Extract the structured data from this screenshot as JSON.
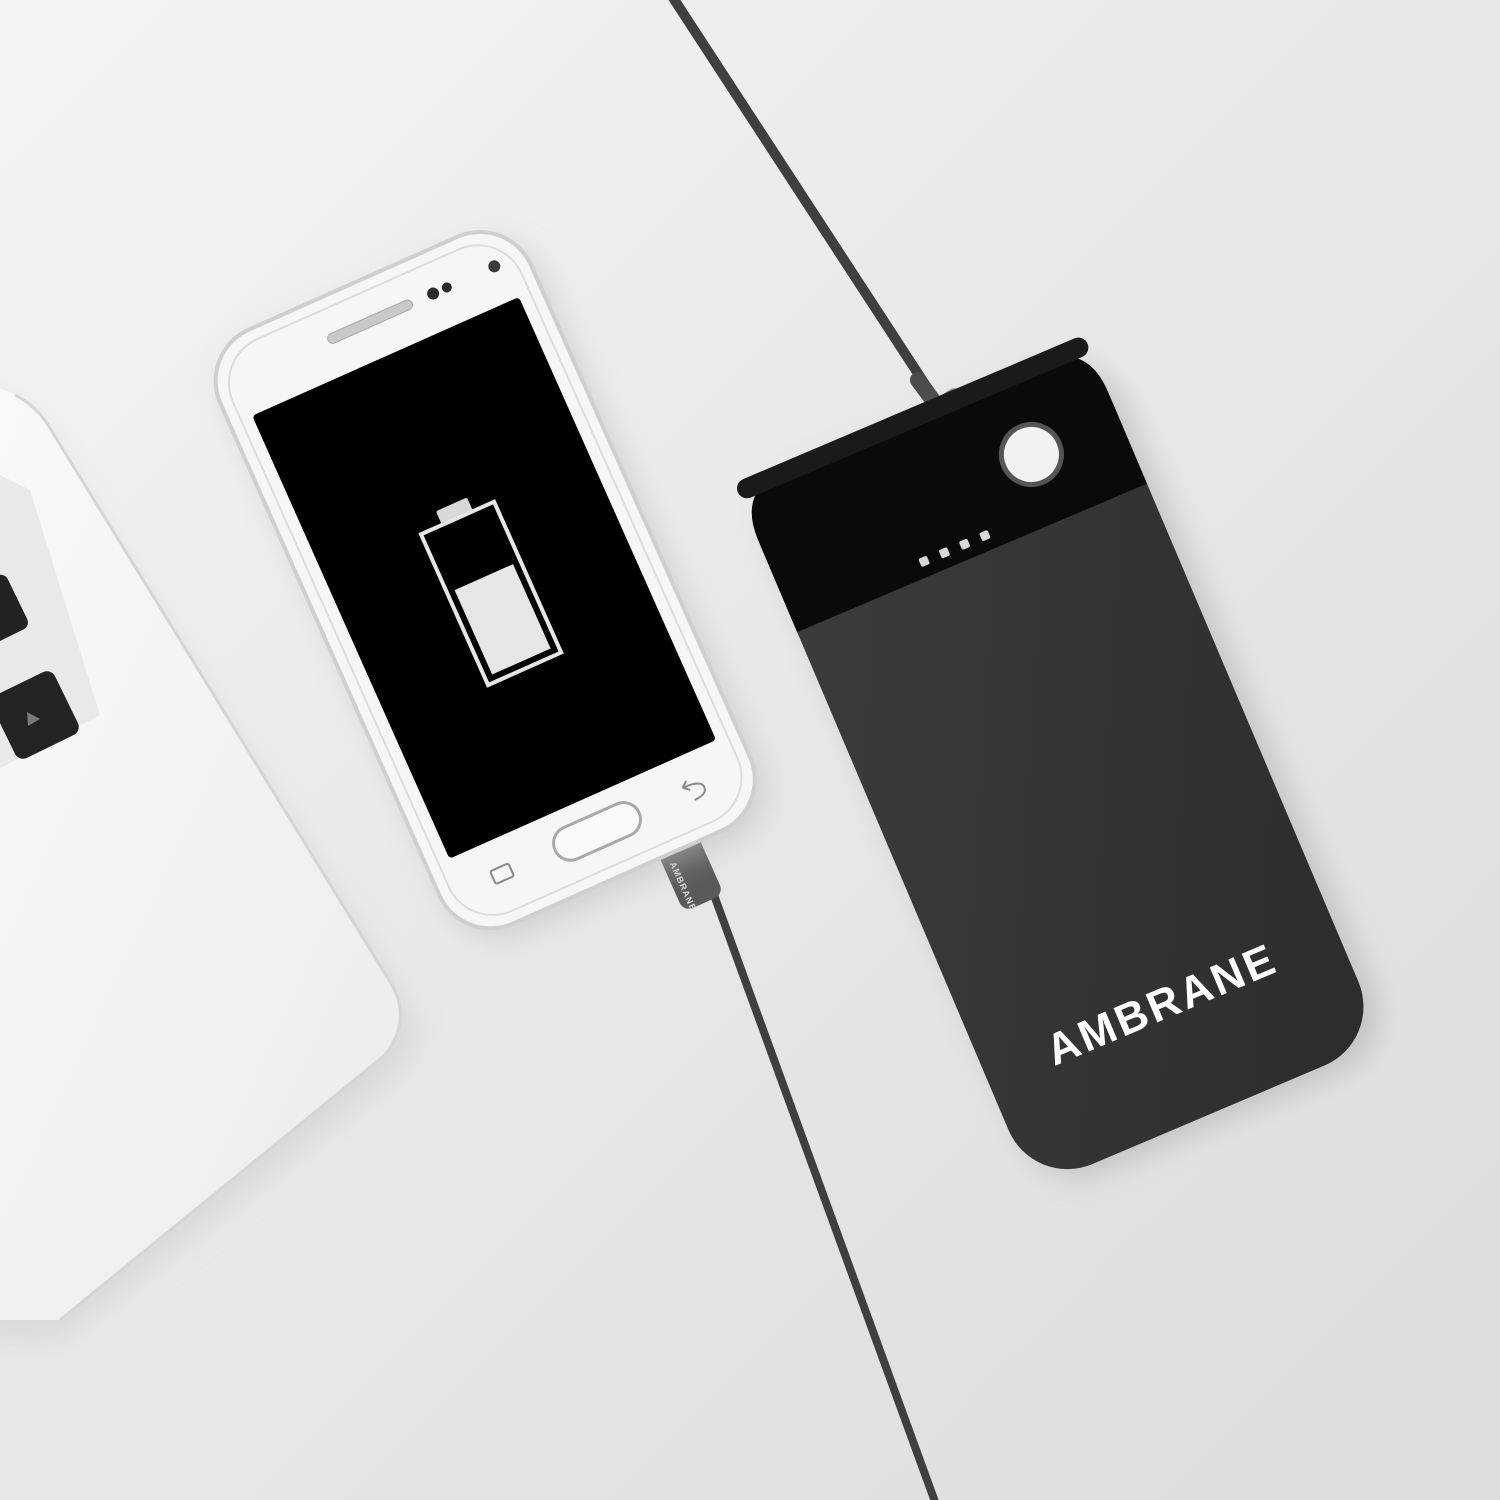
{
  "scene": {
    "description_free": true,
    "colors": {
      "background": "#e4e4e4",
      "laptop": "#f1f1f1",
      "phone_body": "#f6f6f6",
      "phone_screen": "#000000",
      "powerbank_body": "#363636",
      "powerbank_top": "#0a0a0a",
      "cable": "#3f3f41",
      "led_indicator": "#d8d8d8"
    }
  },
  "phone": {
    "screen_icon": "battery-charging-icon",
    "battery_level": 0.62
  },
  "powerbank": {
    "brand": "AMBRANE",
    "led_count": 4,
    "button_icon": "power-button-icon"
  },
  "cable": {
    "brand": "AMBRANE"
  }
}
